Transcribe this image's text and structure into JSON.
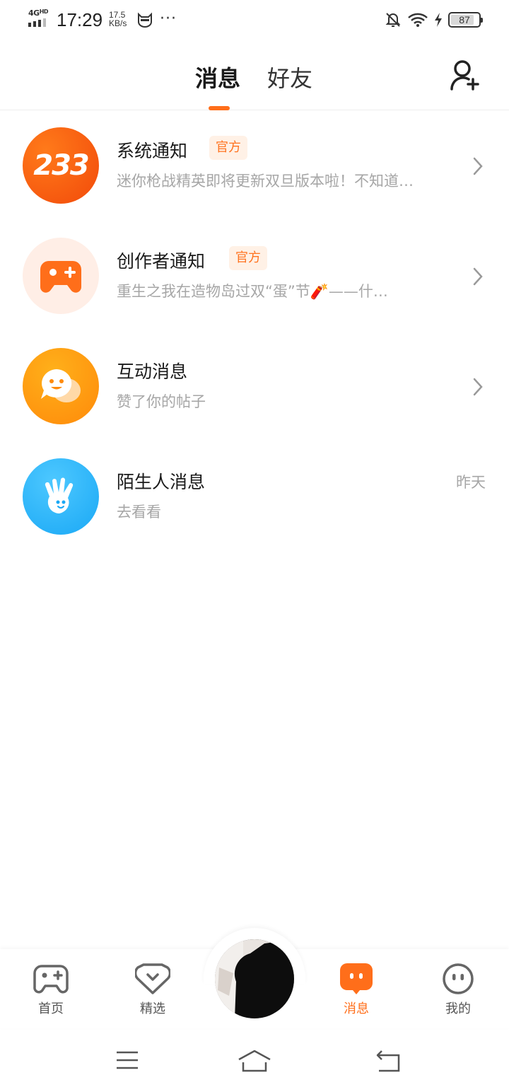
{
  "status_bar": {
    "network": "4G",
    "network_sup": "HD",
    "time": "17:29",
    "speed_value": "17.5",
    "speed_unit": "KB/s",
    "more": "···",
    "battery": "87"
  },
  "header": {
    "tabs": [
      {
        "label": "消息",
        "active": true
      },
      {
        "label": "好友",
        "active": false
      }
    ],
    "add_friend_icon": "add-user-icon",
    "accent_color": "#ff6e1a"
  },
  "messages": [
    {
      "title": "系统通知",
      "badge": "官方",
      "subtitle": "迷你枪战精英即将更新双旦版本啦！不知道…",
      "avatar_text": "233",
      "avatar_icon": "logo-233-icon"
    },
    {
      "title": "创作者通知",
      "badge": "官方",
      "subtitle": "重生之我在造物岛过双“蛋”节🧨——什…",
      "avatar_icon": "gamepad-plus-icon"
    },
    {
      "title": "互动消息",
      "subtitle": "赞了你的帖子",
      "avatar_icon": "smile-bubble-icon"
    },
    {
      "title": "陌生人消息",
      "subtitle": "去看看",
      "time": "昨天",
      "avatar_icon": "waving-hand-icon"
    }
  ],
  "bottom_nav": [
    {
      "label": "首页",
      "icon": "gamepad-icon",
      "active": false
    },
    {
      "label": "精选",
      "icon": "heart-chevron-icon",
      "active": false
    },
    {
      "label": "消息",
      "icon": "chat-bubble-icon",
      "active": true
    },
    {
      "label": "我的",
      "icon": "face-icon",
      "active": false
    }
  ],
  "system_nav": [
    "menu-icon",
    "home-icon",
    "back-icon"
  ]
}
